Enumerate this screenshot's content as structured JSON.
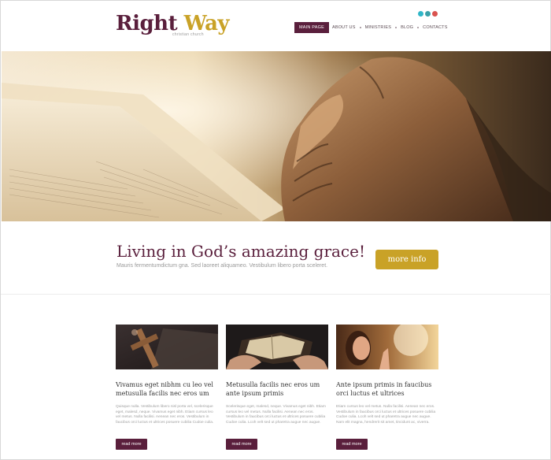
{
  "logo": {
    "word1": "Right",
    "word2": "Way",
    "tagline": "christian church"
  },
  "social": [
    {
      "icon": "twitter-icon",
      "color": "#2fb6c8"
    },
    {
      "icon": "facebook-icon",
      "color": "#3aa0a8"
    },
    {
      "icon": "google-plus-icon",
      "color": "#d9534f"
    }
  ],
  "nav": {
    "items": [
      "MAIN PAGE",
      "ABOUT US",
      "MINISTRIES",
      "BLOG",
      "CONTACTS"
    ],
    "active_index": 0
  },
  "hero": {
    "image": "bible-and-praying-hands-photo"
  },
  "intro": {
    "headline": "Living in God’s amazing grace!",
    "subline": "Mauris fermentumdictum gna.  Sed laoreet aliquameo. Vestibulum libero porta sceleret.",
    "button": "more info"
  },
  "cards": [
    {
      "image": "wooden-cross-on-bible-photo",
      "title": "Vivamus eget nibhm cu leo vel metusulla facilis nec eros um",
      "body": "Quisque nulla. Vestibulum libero nisl porta vel, scelerisque eget, malesd, neque. Vivamus eget nibh. Etiam cursus leo vel metus. Nulla facilisi. Aenean nec eros. Vestibulum in faucibus orci luctus et ultrices posuere cubilia Cudoe culia.",
      "button": "read more"
    },
    {
      "image": "hands-holding-bible-photo",
      "title": "Metusulla facilis nec eros um ante ipsum primis",
      "body": "Scelerisque eget, malesd, neque. Vivamus eget nibh. Etiam cursus leo vel metus. Nulla facilisi. Aenean nec eros. Vestibulum in faucibus orci luctus et ultrices posuere cubilia Cudoe culia. Lcoh velt sed ut pharetra augue nec augue.",
      "button": "read more"
    },
    {
      "image": "woman-praying-in-light-photo",
      "title": "Ante ipsum primis  in faucibus orci luctus et ultrices",
      "body": "Etiam cursus leo vel metus. Nulla facilisi. Aenean nec eros. Vestibulum in faucibus orci luctus et ultrices posuere cubilia Cudoe culia. Lcoh velt sed ut pharetra augue nec augue. Nam elit magna, hendrerit sit amet, tincidunt ac, viverra.",
      "button": "read more"
    }
  ]
}
